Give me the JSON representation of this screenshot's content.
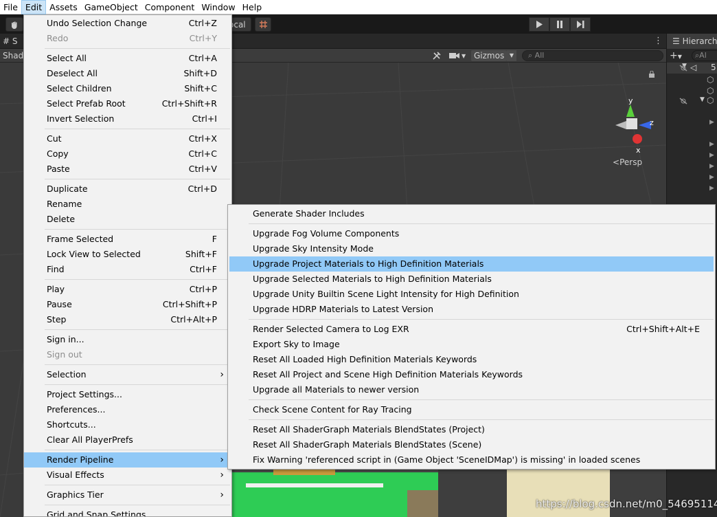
{
  "menubar": {
    "items": [
      "File",
      "Edit",
      "Assets",
      "GameObject",
      "Component",
      "Window",
      "Help"
    ]
  },
  "toolbar": {
    "local_label": "ocal"
  },
  "scene": {
    "tab_label": "S",
    "shading_label": "Shad",
    "gizmos_label": "Gizmos",
    "search_placeholder": "All",
    "persp_label": "Persp",
    "axis_labels": {
      "y": "y",
      "z": "z",
      "x": "x"
    }
  },
  "hierarchy": {
    "tab_label": "Hierarch",
    "search_placeholder": "Al",
    "add_label": "+",
    "scene_number": "5"
  },
  "edit_menu": {
    "items": [
      {
        "label": "Undo Selection Change",
        "shortcut": "Ctrl+Z"
      },
      {
        "label": "Redo",
        "shortcut": "Ctrl+Y"
      },
      {
        "label": "Select All",
        "shortcut": "Ctrl+A"
      },
      {
        "label": "Deselect All",
        "shortcut": "Shift+D"
      },
      {
        "label": "Select Children",
        "shortcut": "Shift+C"
      },
      {
        "label": "Select Prefab Root",
        "shortcut": "Ctrl+Shift+R"
      },
      {
        "label": "Invert Selection",
        "shortcut": "Ctrl+I"
      },
      {
        "label": "Cut",
        "shortcut": "Ctrl+X"
      },
      {
        "label": "Copy",
        "shortcut": "Ctrl+C"
      },
      {
        "label": "Paste",
        "shortcut": "Ctrl+V"
      },
      {
        "label": "Duplicate",
        "shortcut": "Ctrl+D"
      },
      {
        "label": "Rename",
        "shortcut": ""
      },
      {
        "label": "Delete",
        "shortcut": ""
      },
      {
        "label": "Frame Selected",
        "shortcut": "F"
      },
      {
        "label": "Lock View to Selected",
        "shortcut": "Shift+F"
      },
      {
        "label": "Find",
        "shortcut": "Ctrl+F"
      },
      {
        "label": "Play",
        "shortcut": "Ctrl+P"
      },
      {
        "label": "Pause",
        "shortcut": "Ctrl+Shift+P"
      },
      {
        "label": "Step",
        "shortcut": "Ctrl+Alt+P"
      },
      {
        "label": "Sign in...",
        "shortcut": ""
      },
      {
        "label": "Sign out",
        "shortcut": ""
      },
      {
        "label": "Selection",
        "shortcut": ""
      },
      {
        "label": "Project Settings...",
        "shortcut": ""
      },
      {
        "label": "Preferences...",
        "shortcut": ""
      },
      {
        "label": "Shortcuts...",
        "shortcut": ""
      },
      {
        "label": "Clear All PlayerPrefs",
        "shortcut": ""
      },
      {
        "label": "Render Pipeline",
        "shortcut": ""
      },
      {
        "label": "Visual Effects",
        "shortcut": ""
      },
      {
        "label": "Graphics Tier",
        "shortcut": ""
      },
      {
        "label": "Grid and Snap Settings...",
        "shortcut": ""
      }
    ]
  },
  "render_pipeline_menu": {
    "items": [
      {
        "label": "Generate Shader Includes",
        "shortcut": ""
      },
      {
        "label": "Upgrade Fog Volume Components",
        "shortcut": ""
      },
      {
        "label": "Upgrade Sky Intensity Mode",
        "shortcut": ""
      },
      {
        "label": "Upgrade Project Materials to High Definition Materials",
        "shortcut": ""
      },
      {
        "label": "Upgrade Selected Materials to High Definition Materials",
        "shortcut": ""
      },
      {
        "label": "Upgrade Unity Builtin Scene Light Intensity for High Definition",
        "shortcut": ""
      },
      {
        "label": "Upgrade HDRP Materials to Latest Version",
        "shortcut": ""
      },
      {
        "label": "Render Selected Camera to Log EXR",
        "shortcut": "Ctrl+Shift+Alt+E"
      },
      {
        "label": "Export Sky to Image",
        "shortcut": ""
      },
      {
        "label": "Reset All Loaded High Definition Materials Keywords",
        "shortcut": ""
      },
      {
        "label": "Reset All Project and Scene High Definition Materials Keywords",
        "shortcut": ""
      },
      {
        "label": "Upgrade all Materials to newer version",
        "shortcut": ""
      },
      {
        "label": "Check Scene Content for Ray Tracing",
        "shortcut": ""
      },
      {
        "label": "Reset All ShaderGraph Materials BlendStates (Project)",
        "shortcut": ""
      },
      {
        "label": "Reset All ShaderGraph Materials BlendStates (Scene)",
        "shortcut": ""
      },
      {
        "label": "Fix Warning 'referenced script in (Game Object 'SceneIDMap') is missing' in loaded scenes",
        "shortcut": ""
      }
    ]
  },
  "watermark": "https://blog.csdn.net/m0_54695114",
  "colors": {
    "menu_bg": "#f2f2f2",
    "highlight": "#91c9f7",
    "editor_dark": "#282828",
    "scene_bg": "#3a3a3a"
  }
}
